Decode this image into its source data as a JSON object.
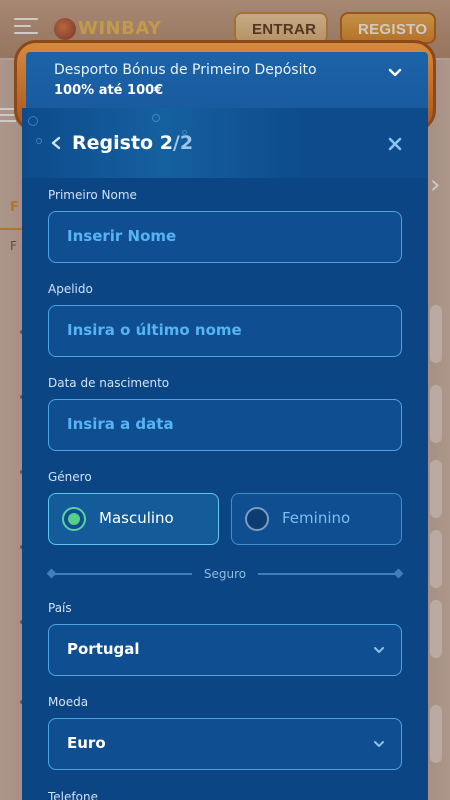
{
  "header": {
    "logo_text": "WINBAY",
    "login_label": "ENTRAR",
    "register_label": "REGISTO"
  },
  "background": {
    "tab_initial": "F",
    "sub_initial": "F"
  },
  "bonus": {
    "title": "Desporto Bónus de Primeiro Depósito",
    "offer": "100% até 100€"
  },
  "modal": {
    "title_prefix": "Registo 2",
    "title_suffix": "/2"
  },
  "form": {
    "first_name": {
      "label": "Primeiro Nome",
      "placeholder": "Inserir Nome"
    },
    "last_name": {
      "label": "Apelido",
      "placeholder": "Insira o último nome"
    },
    "birth_date": {
      "label": "Data de nascimento",
      "placeholder": "Insira a data"
    },
    "gender": {
      "label": "Género",
      "options": [
        {
          "label": "Masculino",
          "selected": true
        },
        {
          "label": "Feminino",
          "selected": false
        }
      ]
    },
    "secure_divider": "Seguro",
    "country": {
      "label": "País",
      "value": "Portugal"
    },
    "currency": {
      "label": "Moeda",
      "value": "Euro"
    },
    "phone": {
      "label": "Telefone"
    }
  },
  "colors": {
    "modal_bg": "#0c4584",
    "input_border": "#4ea3e4",
    "placeholder_text": "#57b4f3",
    "register_button": "#df8a2a",
    "selected_radio": "#54d08a"
  }
}
